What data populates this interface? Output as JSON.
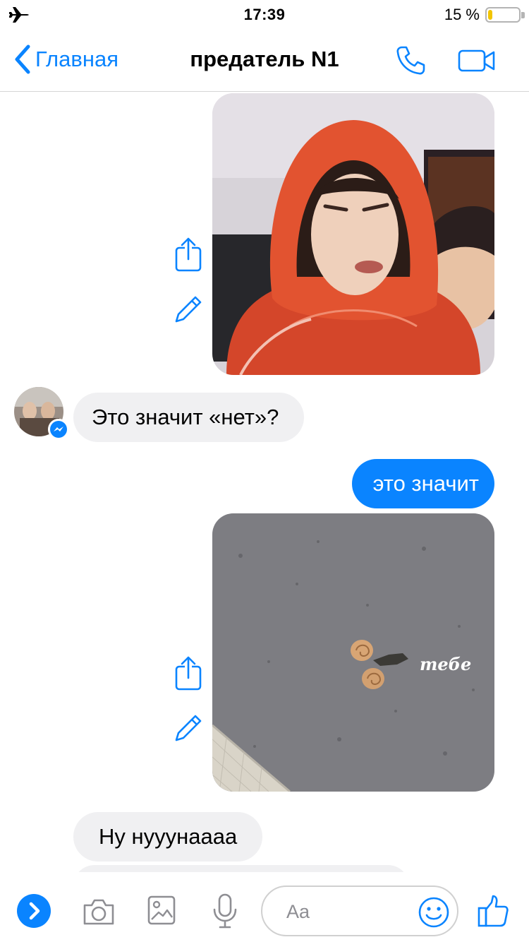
{
  "status_bar": {
    "time": "17:39",
    "battery_percent": "15 %",
    "battery_level": 0.15,
    "airplane_icon": "airplane-icon"
  },
  "header": {
    "back_label": "Главная",
    "title": "предатель N1",
    "call_icon": "phone-icon",
    "video_icon": "video-camera-icon"
  },
  "messages": [
    {
      "kind": "photo",
      "direction": "outgoing",
      "description_icon": "photo-hooded-person"
    },
    {
      "kind": "text",
      "direction": "incoming",
      "text": "Это значит «нет»?"
    },
    {
      "kind": "text",
      "direction": "outgoing",
      "text": "это значит"
    },
    {
      "kind": "photo",
      "direction": "outgoing",
      "caption": "тебе"
    },
    {
      "kind": "text",
      "direction": "incoming",
      "text": "Ну нууунаааа"
    }
  ],
  "composer": {
    "placeholder": "Aa",
    "icons": [
      "chevron-right-icon",
      "camera-icon",
      "gallery-icon",
      "microphone-icon",
      "smile-icon",
      "thumbs-up-icon"
    ]
  },
  "colors": {
    "accent": "#0a84ff",
    "incoming_bubble": "#f0f0f2",
    "battery_fill": "#f2c500"
  }
}
